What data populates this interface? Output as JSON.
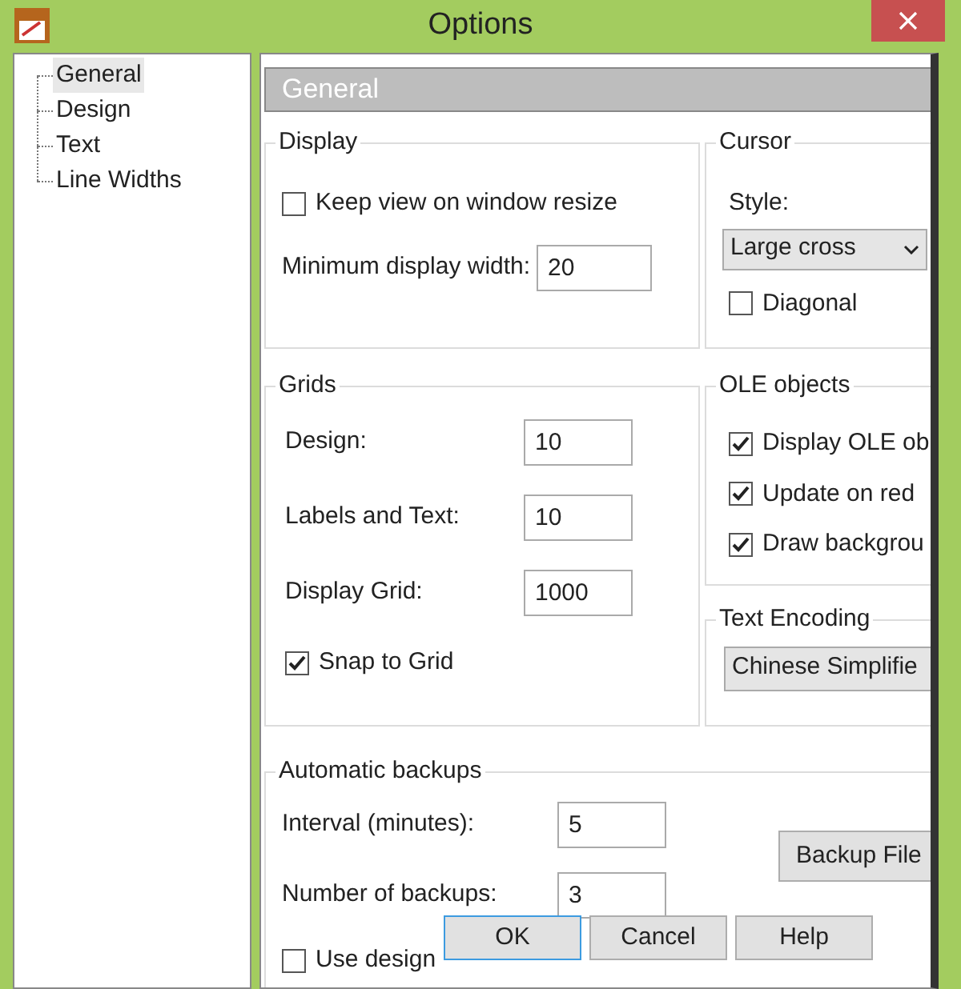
{
  "window": {
    "title": "Options"
  },
  "tree": {
    "items": [
      {
        "label": "General",
        "selected": true
      },
      {
        "label": "Design",
        "selected": false
      },
      {
        "label": "Text",
        "selected": false
      },
      {
        "label": "Line Widths",
        "selected": false
      }
    ]
  },
  "header": "General",
  "display": {
    "title": "Display",
    "keep_view": {
      "label": "Keep view on window resize",
      "checked": false
    },
    "min_width": {
      "label": "Minimum display width:",
      "value": "20"
    }
  },
  "cursor": {
    "title": "Cursor",
    "style_label": "Style:",
    "style_value": "Large cross",
    "diagonal": {
      "label": "Diagonal",
      "checked": false
    }
  },
  "grids": {
    "title": "Grids",
    "fields": [
      {
        "label": "Design:",
        "value": "10"
      },
      {
        "label": "Labels and Text:",
        "value": "10"
      },
      {
        "label": "Display Grid:",
        "value": "1000"
      }
    ],
    "snap": {
      "label": "Snap to Grid",
      "checked": true
    }
  },
  "ole": {
    "title": "OLE objects",
    "options": [
      {
        "label": "Display OLE ob",
        "checked": true
      },
      {
        "label": "Update on red",
        "checked": true
      },
      {
        "label": "Draw backgrou",
        "checked": true
      }
    ]
  },
  "encoding": {
    "title": "Text Encoding",
    "value": "Chinese Simplifie"
  },
  "backups": {
    "title": "Automatic backups",
    "fields": [
      {
        "label": "Interval (minutes):",
        "value": "5"
      },
      {
        "label": "Number of backups:",
        "value": "3"
      }
    ],
    "button": "Backup File",
    "use_design": {
      "label": "Use design",
      "checked": false
    }
  },
  "buttons": [
    {
      "label": "OK",
      "selected": true
    },
    {
      "label": "Cancel",
      "selected": false
    },
    {
      "label": "Help",
      "selected": false
    }
  ]
}
